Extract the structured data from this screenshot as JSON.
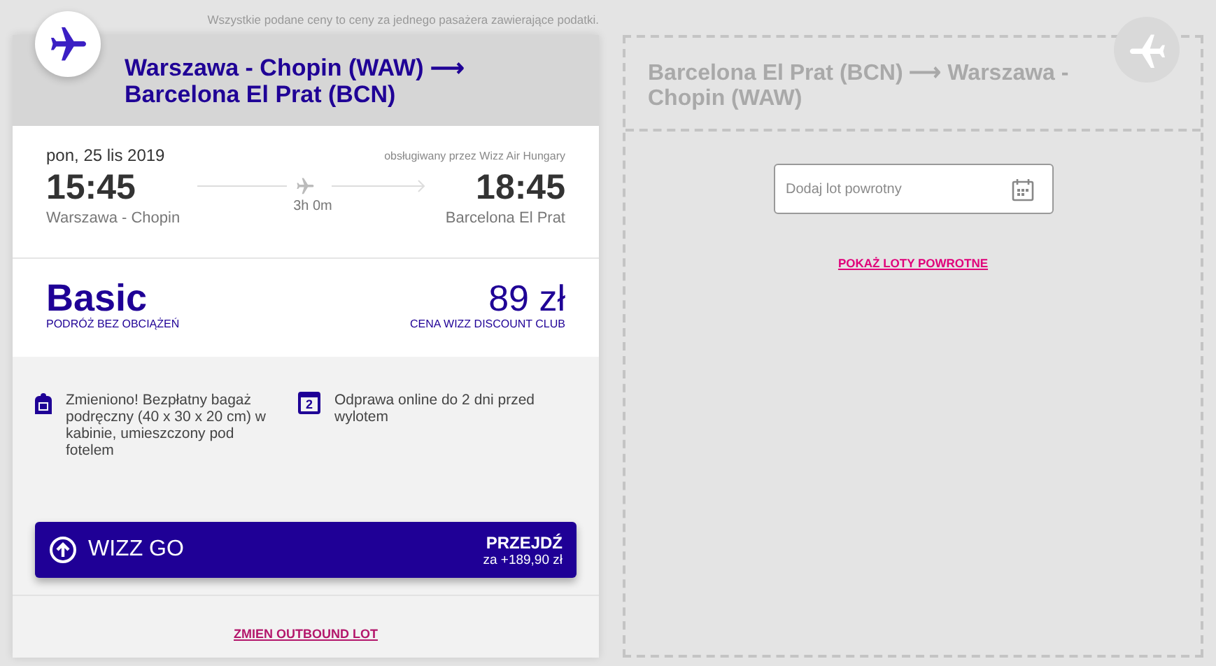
{
  "notice": "Wszystkie podane ceny to ceny za jednego pasażera zawierające podatki.",
  "outbound": {
    "route": "Warszawa - Chopin (WAW) ⟶ Barcelona El Prat (BCN)",
    "date": "pon, 25 lis 2019",
    "operator": "obsługiwany przez Wizz Air Hungary",
    "departure": {
      "time": "15:45",
      "airport": "Warszawa - Chopin"
    },
    "duration": "3h 0m",
    "arrival": {
      "time": "18:45",
      "airport": "Barcelona El Prat"
    },
    "fare": {
      "name": "Basic",
      "subtitle": "PODRÓŻ BEZ OBCIĄŻEŃ",
      "price": "89 zł",
      "price_note": "CENA WIZZ DISCOUNT CLUB"
    },
    "features": [
      {
        "kind": "bag",
        "text": "Zmieniono! Bezpłatny bagaż podręczny (40 x 30 x 20 cm) w kabinie, umieszczony pod fotelem"
      },
      {
        "kind": "calendar",
        "icon_text": "2",
        "text": "Odprawa online do 2 dni przed wylotem"
      }
    ],
    "upgrade": {
      "label": "WIZZ GO",
      "action": "PRZEJDŹ",
      "price": "za +189,90 zł"
    },
    "change_link": "ZMIEN OUTBOUND LOT"
  },
  "return": {
    "route": "Barcelona El Prat (BCN) ⟶ Warszawa - Chopin (WAW)",
    "date_field": {
      "placeholder": "Dodaj lot powrotny"
    },
    "show_link": "POKAŻ LOTY POWROTNE"
  }
}
